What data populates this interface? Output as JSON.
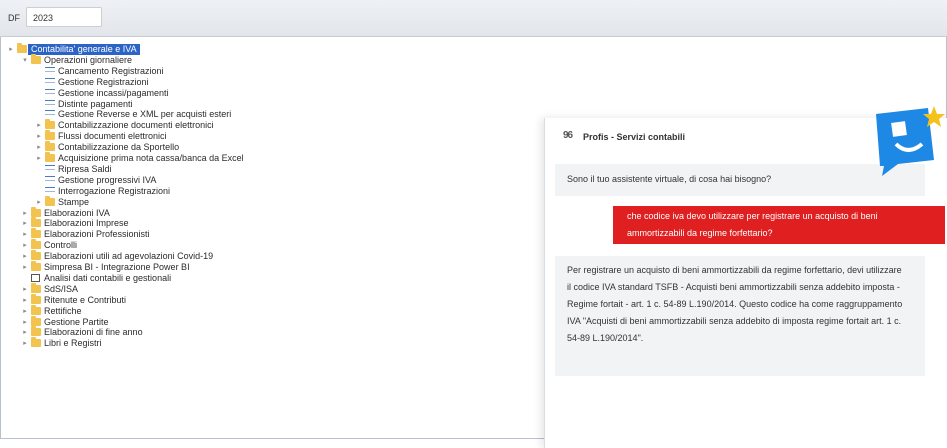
{
  "topbar": {
    "label": "DF",
    "year": "2023"
  },
  "tree": [
    {
      "label": "Contabilita' generale e IVA",
      "type": "folder",
      "level": 0,
      "toggle": "▸",
      "selected": true
    },
    {
      "label": "Operazioni giornaliere",
      "type": "folder",
      "level": 1,
      "toggle": "▾"
    },
    {
      "label": "Cancamento Registrazioni",
      "type": "leaf",
      "level": 2
    },
    {
      "label": "Gestione Registrazioni",
      "type": "leaf",
      "level": 2
    },
    {
      "label": "Gestione incassi/pagamenti",
      "type": "leaf",
      "level": 2
    },
    {
      "label": "Distinte pagamenti",
      "type": "leaf",
      "level": 2
    },
    {
      "label": "Gestione Reverse e XML per acquisti esteri",
      "type": "leaf",
      "level": 2
    },
    {
      "label": "Contabilizzazione documenti elettronici",
      "type": "folder",
      "level": 2,
      "toggle": "▸"
    },
    {
      "label": "Flussi documenti elettronici",
      "type": "folder",
      "level": 2,
      "toggle": "▸"
    },
    {
      "label": "Contabilizzazione da Sportello",
      "type": "folder",
      "level": 2,
      "toggle": "▸"
    },
    {
      "label": "Acquisizione prima nota cassa/banca da Excel",
      "type": "folder",
      "level": 2,
      "toggle": "▸"
    },
    {
      "label": "Ripresa Saldi",
      "type": "leaf",
      "level": 2
    },
    {
      "label": "Gestione progressivi IVA",
      "type": "leaf",
      "level": 2
    },
    {
      "label": "Interrogazione Registrazioni",
      "type": "leaf",
      "level": 2
    },
    {
      "label": "Stampe",
      "type": "folder",
      "level": 2,
      "toggle": "▸"
    },
    {
      "label": "Elaborazioni IVA",
      "type": "folder",
      "level": 1,
      "toggle": "▸"
    },
    {
      "label": "Elaborazioni Imprese",
      "type": "folder",
      "level": 1,
      "toggle": "▸"
    },
    {
      "label": "Elaborazioni Professionisti",
      "type": "folder",
      "level": 1,
      "toggle": "▸"
    },
    {
      "label": "Controlli",
      "type": "folder",
      "level": 1,
      "toggle": "▸"
    },
    {
      "label": "Elaborazioni utili ad agevolazioni Covid-19",
      "type": "folder",
      "level": 1,
      "toggle": "▸"
    },
    {
      "label": "Simpresa BI - Integrazione Power BI",
      "type": "folder",
      "level": 1,
      "toggle": "▸"
    },
    {
      "label": "Analisi dati contabili e gestionali",
      "type": "box",
      "level": 1
    },
    {
      "label": "SdS/ISA",
      "type": "folder",
      "level": 1,
      "toggle": "▸"
    },
    {
      "label": "Ritenute e Contributi",
      "type": "folder",
      "level": 1,
      "toggle": "▸"
    },
    {
      "label": "Rettifiche",
      "type": "folder",
      "level": 1,
      "toggle": "▸"
    },
    {
      "label": "Gestione Partite",
      "type": "folder",
      "level": 1,
      "toggle": "▸"
    },
    {
      "label": "Elaborazioni di fine anno",
      "type": "folder",
      "level": 1,
      "toggle": "▸"
    },
    {
      "label": "Libri e Registri",
      "type": "folder",
      "level": 1,
      "toggle": "▸"
    }
  ],
  "assistant": {
    "logo": "96",
    "title": "Profis - Servizi contabili",
    "greeting": "Sono il tuo assistente virtuale, di cosa hai bisogno?",
    "user_message": "che codice iva devo utilizzare per registrare un acquisto di beni ammortizzabili da regime forfettario?",
    "bot_reply": "Per registrare un acquisto di beni ammortizzabili da regime forfettario, devi utilizzare il codice IVA standard TSFB - Acquisti beni ammortizzabili senza addebito imposta - Regime fortait - art. 1 c. 54-89 L.190/2014. Questo codice ha come raggruppamento IVA \"Acquisti di beni ammortizzabili senza addebito di imposta regime fortait art. 1 c. 54-89 L.190/2014\".",
    "colors": {
      "user_bubble": "#e02020",
      "badge_blue": "#1e88e5",
      "badge_star": "#f5c21b"
    }
  }
}
